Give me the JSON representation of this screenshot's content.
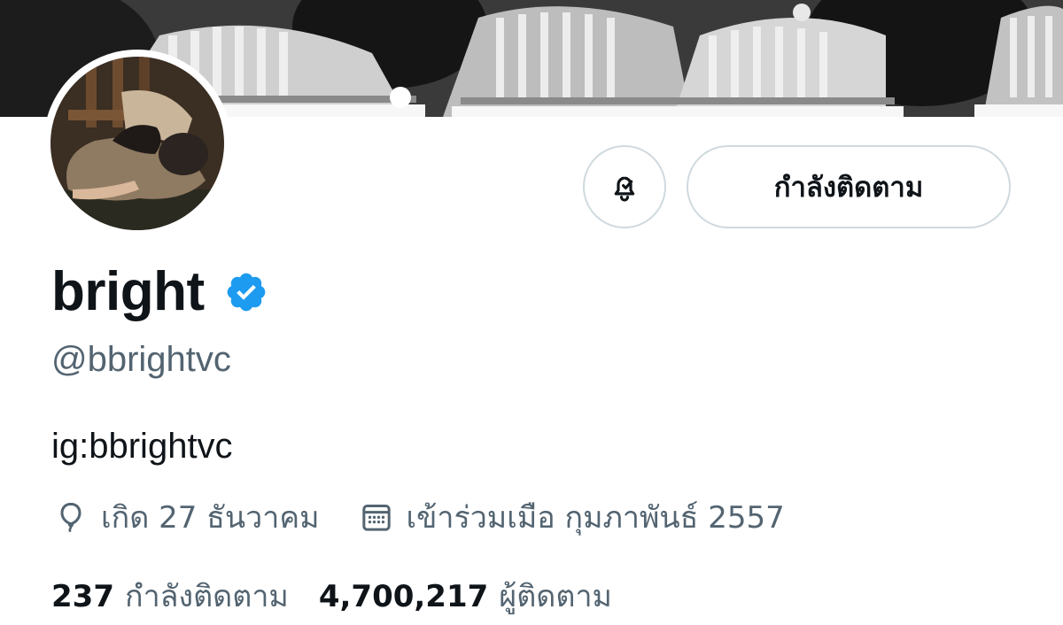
{
  "profile": {
    "display_name": "bright",
    "handle": "@bbrightvc",
    "bio": "ig:bbrightvc",
    "verified_icon": "verified-badge-icon",
    "birthday": "เกิด 27 ธันวาคม",
    "joined": "เข้าร่วมเมือ กุมภาพันธ์ 2557"
  },
  "actions": {
    "notification_icon": "bell-check-icon",
    "follow_label": "กำลังติดตาม"
  },
  "stats": {
    "following_count": "237",
    "following_label": "กำลังติดตาม",
    "followers_count": "4,700,217",
    "followers_label": "ผู้ติดตาม"
  },
  "colors": {
    "verified_blue": "#1d9bf0",
    "secondary_text": "#536471",
    "primary_text": "#0f1419",
    "button_border": "#cfd9de"
  }
}
